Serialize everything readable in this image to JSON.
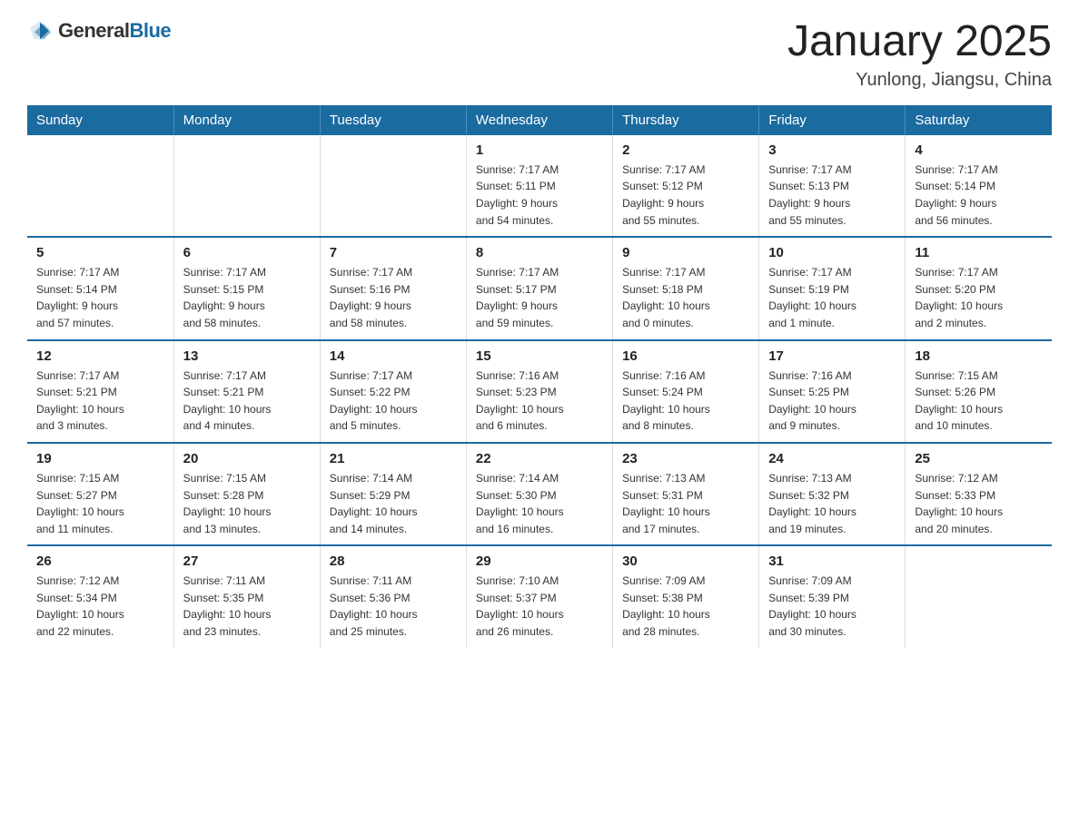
{
  "logo": {
    "general": "General",
    "blue": "Blue"
  },
  "header": {
    "title": "January 2025",
    "location": "Yunlong, Jiangsu, China"
  },
  "columns": [
    "Sunday",
    "Monday",
    "Tuesday",
    "Wednesday",
    "Thursday",
    "Friday",
    "Saturday"
  ],
  "weeks": [
    [
      {
        "num": "",
        "info": ""
      },
      {
        "num": "",
        "info": ""
      },
      {
        "num": "",
        "info": ""
      },
      {
        "num": "1",
        "info": "Sunrise: 7:17 AM\nSunset: 5:11 PM\nDaylight: 9 hours\nand 54 minutes."
      },
      {
        "num": "2",
        "info": "Sunrise: 7:17 AM\nSunset: 5:12 PM\nDaylight: 9 hours\nand 55 minutes."
      },
      {
        "num": "3",
        "info": "Sunrise: 7:17 AM\nSunset: 5:13 PM\nDaylight: 9 hours\nand 55 minutes."
      },
      {
        "num": "4",
        "info": "Sunrise: 7:17 AM\nSunset: 5:14 PM\nDaylight: 9 hours\nand 56 minutes."
      }
    ],
    [
      {
        "num": "5",
        "info": "Sunrise: 7:17 AM\nSunset: 5:14 PM\nDaylight: 9 hours\nand 57 minutes."
      },
      {
        "num": "6",
        "info": "Sunrise: 7:17 AM\nSunset: 5:15 PM\nDaylight: 9 hours\nand 58 minutes."
      },
      {
        "num": "7",
        "info": "Sunrise: 7:17 AM\nSunset: 5:16 PM\nDaylight: 9 hours\nand 58 minutes."
      },
      {
        "num": "8",
        "info": "Sunrise: 7:17 AM\nSunset: 5:17 PM\nDaylight: 9 hours\nand 59 minutes."
      },
      {
        "num": "9",
        "info": "Sunrise: 7:17 AM\nSunset: 5:18 PM\nDaylight: 10 hours\nand 0 minutes."
      },
      {
        "num": "10",
        "info": "Sunrise: 7:17 AM\nSunset: 5:19 PM\nDaylight: 10 hours\nand 1 minute."
      },
      {
        "num": "11",
        "info": "Sunrise: 7:17 AM\nSunset: 5:20 PM\nDaylight: 10 hours\nand 2 minutes."
      }
    ],
    [
      {
        "num": "12",
        "info": "Sunrise: 7:17 AM\nSunset: 5:21 PM\nDaylight: 10 hours\nand 3 minutes."
      },
      {
        "num": "13",
        "info": "Sunrise: 7:17 AM\nSunset: 5:21 PM\nDaylight: 10 hours\nand 4 minutes."
      },
      {
        "num": "14",
        "info": "Sunrise: 7:17 AM\nSunset: 5:22 PM\nDaylight: 10 hours\nand 5 minutes."
      },
      {
        "num": "15",
        "info": "Sunrise: 7:16 AM\nSunset: 5:23 PM\nDaylight: 10 hours\nand 6 minutes."
      },
      {
        "num": "16",
        "info": "Sunrise: 7:16 AM\nSunset: 5:24 PM\nDaylight: 10 hours\nand 8 minutes."
      },
      {
        "num": "17",
        "info": "Sunrise: 7:16 AM\nSunset: 5:25 PM\nDaylight: 10 hours\nand 9 minutes."
      },
      {
        "num": "18",
        "info": "Sunrise: 7:15 AM\nSunset: 5:26 PM\nDaylight: 10 hours\nand 10 minutes."
      }
    ],
    [
      {
        "num": "19",
        "info": "Sunrise: 7:15 AM\nSunset: 5:27 PM\nDaylight: 10 hours\nand 11 minutes."
      },
      {
        "num": "20",
        "info": "Sunrise: 7:15 AM\nSunset: 5:28 PM\nDaylight: 10 hours\nand 13 minutes."
      },
      {
        "num": "21",
        "info": "Sunrise: 7:14 AM\nSunset: 5:29 PM\nDaylight: 10 hours\nand 14 minutes."
      },
      {
        "num": "22",
        "info": "Sunrise: 7:14 AM\nSunset: 5:30 PM\nDaylight: 10 hours\nand 16 minutes."
      },
      {
        "num": "23",
        "info": "Sunrise: 7:13 AM\nSunset: 5:31 PM\nDaylight: 10 hours\nand 17 minutes."
      },
      {
        "num": "24",
        "info": "Sunrise: 7:13 AM\nSunset: 5:32 PM\nDaylight: 10 hours\nand 19 minutes."
      },
      {
        "num": "25",
        "info": "Sunrise: 7:12 AM\nSunset: 5:33 PM\nDaylight: 10 hours\nand 20 minutes."
      }
    ],
    [
      {
        "num": "26",
        "info": "Sunrise: 7:12 AM\nSunset: 5:34 PM\nDaylight: 10 hours\nand 22 minutes."
      },
      {
        "num": "27",
        "info": "Sunrise: 7:11 AM\nSunset: 5:35 PM\nDaylight: 10 hours\nand 23 minutes."
      },
      {
        "num": "28",
        "info": "Sunrise: 7:11 AM\nSunset: 5:36 PM\nDaylight: 10 hours\nand 25 minutes."
      },
      {
        "num": "29",
        "info": "Sunrise: 7:10 AM\nSunset: 5:37 PM\nDaylight: 10 hours\nand 26 minutes."
      },
      {
        "num": "30",
        "info": "Sunrise: 7:09 AM\nSunset: 5:38 PM\nDaylight: 10 hours\nand 28 minutes."
      },
      {
        "num": "31",
        "info": "Sunrise: 7:09 AM\nSunset: 5:39 PM\nDaylight: 10 hours\nand 30 minutes."
      },
      {
        "num": "",
        "info": ""
      }
    ]
  ]
}
